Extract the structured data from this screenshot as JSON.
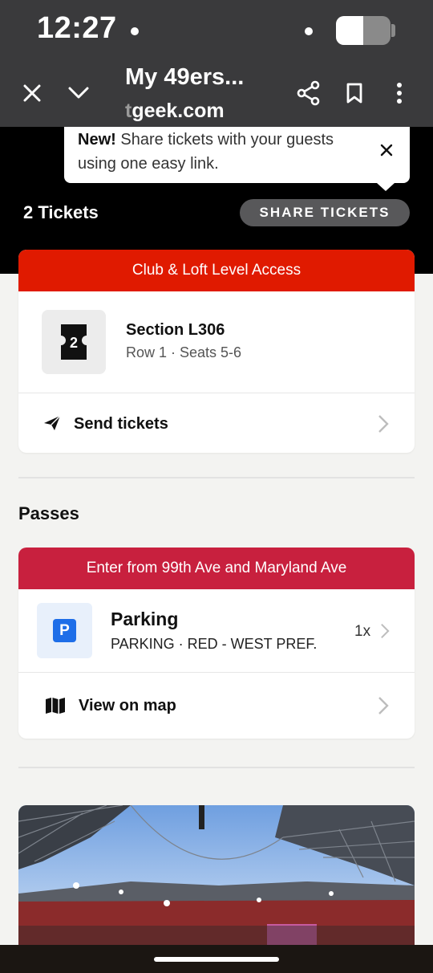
{
  "status_bar": {
    "time": "12:27",
    "battery_level": 0.5
  },
  "toolbar": {
    "title": "My 49ers...",
    "url_faded": "t",
    "url_main": "geek.com",
    "icons": [
      "close-icon",
      "chevron-down-icon",
      "share-icon",
      "bookmark-icon",
      "more-vert-icon"
    ]
  },
  "tooltip": {
    "bold": "New!",
    "text": " Share tickets with your guests using one easy link."
  },
  "header": {
    "tickets_count": "2 Tickets",
    "share_label": "SHARE TICKETS"
  },
  "ticket_card": {
    "banner": "Club & Loft Level Access",
    "banner_color": "#e01a00",
    "ticket_qty": "2",
    "section": "Section L306",
    "seats": "Row 1 · Seats 5-6",
    "send_label": "Send tickets"
  },
  "passes": {
    "heading": "Passes",
    "banner": "Enter from 99th Ave and Maryland Ave",
    "banner_color": "#c8203e",
    "parking_badge": "P",
    "parking_title": "Parking",
    "parking_sub": "PARKING · RED - WEST PREF.",
    "parking_qty": "1x",
    "map_label": "View on map"
  }
}
